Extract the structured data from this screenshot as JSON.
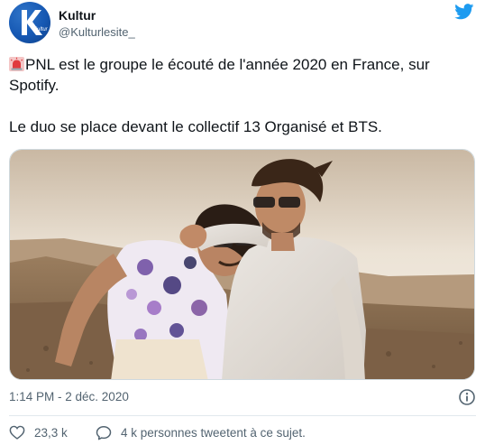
{
  "account": {
    "display_name": "Kultur",
    "handle": "@Kulturlesite_",
    "avatar_letter": "K",
    "avatar_text": "Kultur",
    "brand_color": "#1658b3"
  },
  "tweet": {
    "emoji": "rotating-light",
    "line1": "PNL est le groupe le écouté de l'année 2020 en France, sur Spotify.",
    "line2": "Le duo se place devant le collectif 13 Organisé et BTS.",
    "timestamp": "1:14 PM - 2 déc. 2020"
  },
  "media": {
    "type": "photo",
    "description_icon": "photo-two-men-desert"
  },
  "actions": {
    "likes": "23,3 k",
    "comments": "4 k personnes tweetent à ce sujet."
  },
  "icons": {
    "logo": "twitter-bird-icon",
    "info": "info-icon",
    "like": "heart-icon",
    "comment": "comment-icon"
  },
  "colors": {
    "twitter_blue": "#1d9bf0",
    "text": "#0f1419",
    "secondary": "#536471"
  }
}
